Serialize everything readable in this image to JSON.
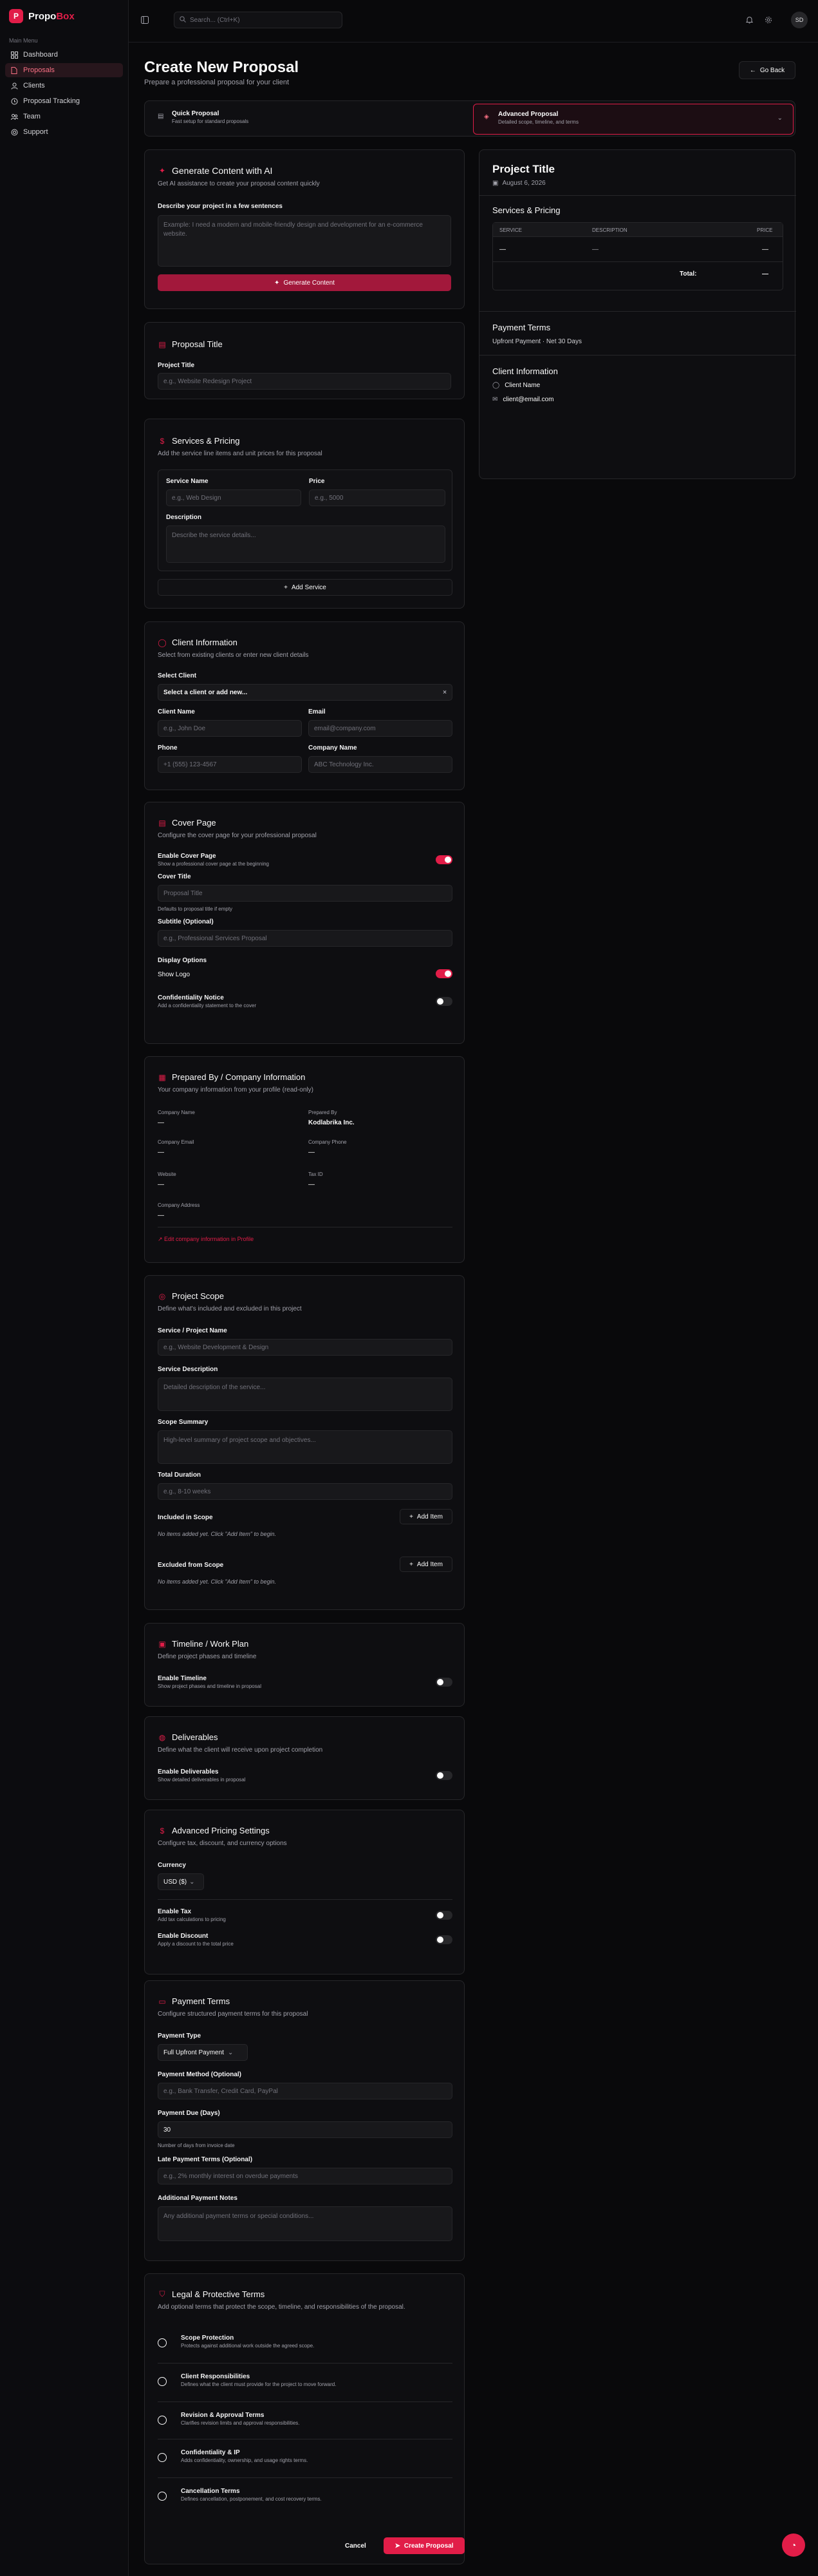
{
  "app": {
    "brand_first": "Propo",
    "brand_second": "Box",
    "logo_letter": "P"
  },
  "sidebar": {
    "section_label": "Main Menu",
    "items": [
      {
        "label": "Dashboard",
        "icon": "dashboard-icon"
      },
      {
        "label": "Proposals",
        "icon": "file-icon"
      },
      {
        "label": "Clients",
        "icon": "users-icon"
      },
      {
        "label": "Proposal Tracking",
        "icon": "tracking-icon"
      },
      {
        "label": "Team",
        "icon": "team-icon"
      },
      {
        "label": "Support",
        "icon": "support-icon"
      }
    ]
  },
  "topbar": {
    "search_placeholder": "Search... (Ctrl+K)",
    "avatar_initials": "SD"
  },
  "page": {
    "title": "Create New Proposal",
    "subtitle": "Prepare a professional proposal for your client",
    "go_back": "Go Back"
  },
  "modes": {
    "quick": {
      "title": "Quick Proposal",
      "desc": "Fast setup for standard proposals"
    },
    "advanced": {
      "title": "Advanced Proposal",
      "desc": "Detailed scope, timeline, and terms"
    }
  },
  "ai": {
    "title": "Generate Content with AI",
    "desc": "Get AI assistance to create your proposal content quickly",
    "label": "Describe your project in a few sentences",
    "placeholder": "Example: I need a modern and mobile-friendly design and development for an e-commerce website.",
    "button": "Generate Content"
  },
  "proposal_title": {
    "title": "Proposal Title",
    "label": "Project Title",
    "placeholder": "e.g., Website Redesign Project"
  },
  "services": {
    "title": "Services & Pricing",
    "desc": "Add the service line items and unit prices for this proposal",
    "name_label": "Service Name",
    "name_placeholder": "e.g., Web Design",
    "price_label": "Price",
    "price_placeholder": "e.g., 5000",
    "desc_label": "Description",
    "desc_placeholder": "Describe the service details...",
    "add_button": "Add Service"
  },
  "client": {
    "title": "Client Information",
    "desc": "Select from existing clients or enter new client details",
    "select_label": "Select Client",
    "select_value": "Select a client or add new...",
    "name_label": "Client Name",
    "name_placeholder": "e.g., John Doe",
    "email_label": "Email",
    "email_placeholder": "email@company.com",
    "phone_label": "Phone",
    "phone_placeholder": "+1 (555) 123-4567",
    "company_label": "Company Name",
    "company_placeholder": "ABC Technology Inc."
  },
  "cover": {
    "title": "Cover Page",
    "desc": "Configure the cover page for your professional proposal",
    "enable_label": "Enable Cover Page",
    "enable_desc": "Show a professional cover page at the beginning",
    "cover_title_label": "Cover Title",
    "cover_title_placeholder": "Proposal Title",
    "cover_title_hint": "Defaults to proposal title if empty",
    "subtitle_label": "Subtitle (Optional)",
    "subtitle_placeholder": "e.g., Professional Services Proposal",
    "display_label": "Display Options",
    "show_logo": "Show Logo",
    "conf_label": "Confidentiality Notice",
    "conf_desc": "Add a confidentiality statement to the cover"
  },
  "company": {
    "title": "Prepared By / Company Information",
    "desc": "Your company information from your profile (read-only)",
    "name_label": "Company Name",
    "name_value": "—",
    "prepared_label": "Prepared By",
    "prepared_value": "Kodlabrika Inc.",
    "email_label": "Company Email",
    "email_value": "—",
    "phone_label": "Company Phone",
    "phone_value": "—",
    "website_label": "Website",
    "website_value": "—",
    "tax_label": "Tax ID",
    "tax_value": "—",
    "address_label": "Company Address",
    "address_value": "—",
    "edit_link": "Edit company information in Profile"
  },
  "scope": {
    "title": "Project Scope",
    "desc": "Define what's included and excluded in this project",
    "service_label": "Service / Project Name",
    "service_placeholder": "e.g., Website Development & Design",
    "sdesc_label": "Service Description",
    "sdesc_placeholder": "Detailed description of the service...",
    "summary_label": "Scope Summary",
    "summary_placeholder": "High-level summary of project scope and objectives...",
    "duration_label": "Total Duration",
    "duration_placeholder": "e.g., 8-10 weeks",
    "included_label": "Included in Scope",
    "excluded_label": "Excluded from Scope",
    "add_item": "Add Item",
    "empty": "No items added yet. Click \"Add Item\" to begin."
  },
  "timeline": {
    "title": "Timeline / Work Plan",
    "desc": "Define project phases and timeline",
    "enable_label": "Enable Timeline",
    "enable_desc": "Show project phases and timeline in proposal"
  },
  "deliverables": {
    "title": "Deliverables",
    "desc": "Define what the client will receive upon project completion",
    "enable_label": "Enable Deliverables",
    "enable_desc": "Show detailed deliverables in proposal"
  },
  "advanced_pricing": {
    "title": "Advanced Pricing Settings",
    "desc": "Configure tax, discount, and currency options",
    "currency_label": "Currency",
    "currency_value": "USD ($)",
    "tax_label": "Enable Tax",
    "tax_desc": "Add tax calculations to pricing",
    "discount_label": "Enable Discount",
    "discount_desc": "Apply a discount to the total price"
  },
  "payment": {
    "title": "Payment Terms",
    "desc": "Configure structured payment terms for this proposal",
    "type_label": "Payment Type",
    "type_value": "Full Upfront Payment",
    "method_label": "Payment Method (Optional)",
    "method_placeholder": "e.g., Bank Transfer, Credit Card, PayPal",
    "due_label": "Payment Due (Days)",
    "due_value": "30",
    "due_hint": "Number of days from invoice date",
    "late_label": "Late Payment Terms (Optional)",
    "late_placeholder": "e.g., 2% monthly interest on overdue payments",
    "notes_label": "Additional Payment Notes",
    "notes_placeholder": "Any additional payment terms or special conditions..."
  },
  "legal": {
    "title": "Legal & Protective Terms",
    "desc": "Add optional terms that protect the scope, timeline, and responsibilities of the proposal.",
    "items": [
      {
        "title": "Scope Protection",
        "desc": "Protects against additional work outside the agreed scope."
      },
      {
        "title": "Client Responsibilities",
        "desc": "Defines what the client must provide for the project to move forward."
      },
      {
        "title": "Revision & Approval Terms",
        "desc": "Clarifies revision limits and approval responsibilities."
      },
      {
        "title": "Confidentiality & IP",
        "desc": "Adds confidentiality, ownership, and usage rights terms."
      },
      {
        "title": "Cancellation Terms",
        "desc": "Defines cancellation, postponement, and cost recovery terms."
      }
    ]
  },
  "actions": {
    "cancel": "Cancel",
    "create": "Create Proposal"
  },
  "preview": {
    "title": "Project Title",
    "date": "August 6, 2026",
    "services_title": "Services & Pricing",
    "col_service": "SERVICE",
    "col_desc": "DESCRIPTION",
    "col_price": "PRICE",
    "row_service": "—",
    "row_desc": "—",
    "row_price": "—",
    "total_label": "Total:",
    "total_value": "—",
    "payment_title": "Payment Terms",
    "payment_value": "Upfront Payment · Net 30 Days",
    "client_title": "Client Information",
    "client_name": "Client Name",
    "client_email": "client@email.com"
  },
  "colors": {
    "accent": "#e11d48",
    "background": "#09090b"
  }
}
